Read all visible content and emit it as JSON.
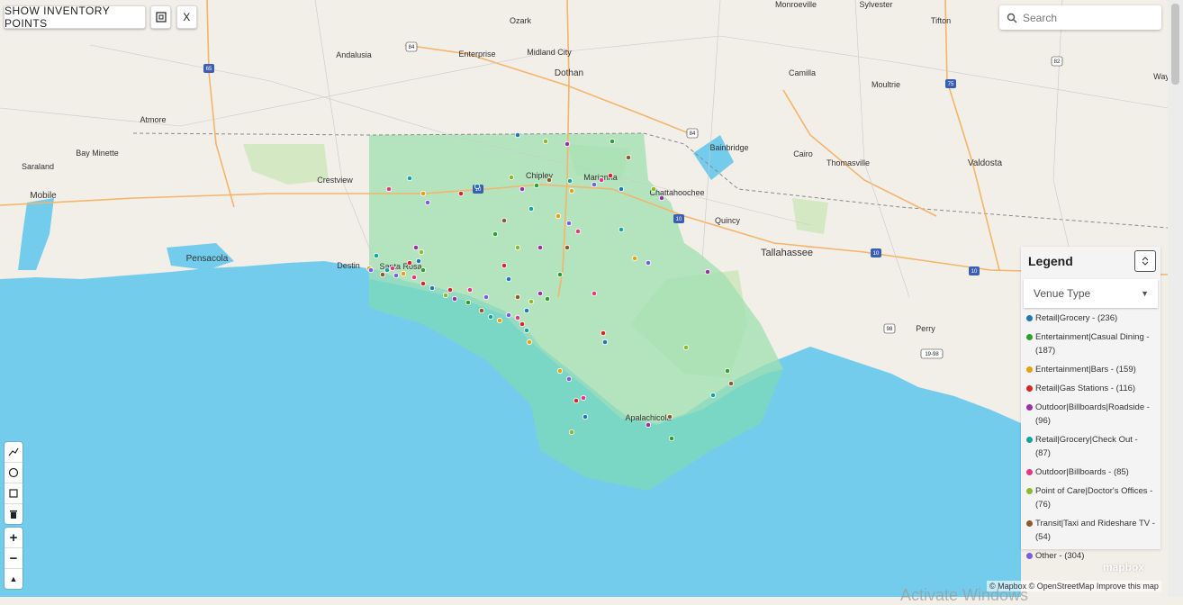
{
  "toolbar": {
    "show_points_label": "SHOW INVENTORY POINTS",
    "close_label": "X"
  },
  "search": {
    "placeholder": "Search"
  },
  "legend": {
    "title": "Legend",
    "select_value": "Venue Type",
    "items": [
      {
        "label": "Retail|Grocery - (236)",
        "color": "#1f77b4"
      },
      {
        "label": "Entertainment|Casual Dining - (187)",
        "color": "#2ca02c"
      },
      {
        "label": "Entertainment|Bars - (159)",
        "color": "#e6a010"
      },
      {
        "label": "Retail|Gas Stations - (116)",
        "color": "#d62728"
      },
      {
        "label": "Outdoor|Billboards|Roadside - (96)",
        "color": "#9c2ea6"
      },
      {
        "label": "Retail|Grocery|Check Out - (87)",
        "color": "#17a2a0"
      },
      {
        "label": "Outdoor|Billboards - (85)",
        "color": "#e3397f"
      },
      {
        "label": "Point of Care|Doctor's Offices - (76)",
        "color": "#8bbb2a"
      },
      {
        "label": "Transit|Taxi and Rideshare TV - (54)",
        "color": "#8c5a2b"
      },
      {
        "label": "Other - (304)",
        "color": "#7b5ce0"
      }
    ]
  },
  "map": {
    "places": [
      "Monroeville",
      "Ozark",
      "Sylvester",
      "Tifton",
      "Andalusia",
      "Enterprise",
      "Midland City",
      "Dothan",
      "Camilla",
      "Moultrie",
      "Atmore",
      "Bay Minette",
      "Saraland",
      "Mobile",
      "Bainbridge",
      "Cairo",
      "Thomasville",
      "Valdosta",
      "Crestview",
      "Chipley",
      "Marianna",
      "Chattahoochee",
      "Quincy",
      "Tallahassee",
      "Pensacola",
      "Destin",
      "Santa Rosa",
      "Perry",
      "Apalachicola",
      "Way"
    ],
    "road_shields": [
      "65",
      "84",
      "84",
      "82",
      "75",
      "10",
      "10",
      "10",
      "10",
      "98",
      "19-98"
    ],
    "tools": [
      "line-tool-icon",
      "circle-tool-icon",
      "polygon-tool-icon",
      "trash-icon"
    ],
    "zoom_in": "+",
    "zoom_out": "−",
    "compass": "▲"
  },
  "attribution": "© Mapbox © OpenStreetMap  Improve this map",
  "mapbox_logo": "mapbox",
  "watermark": "Activate Windows"
}
